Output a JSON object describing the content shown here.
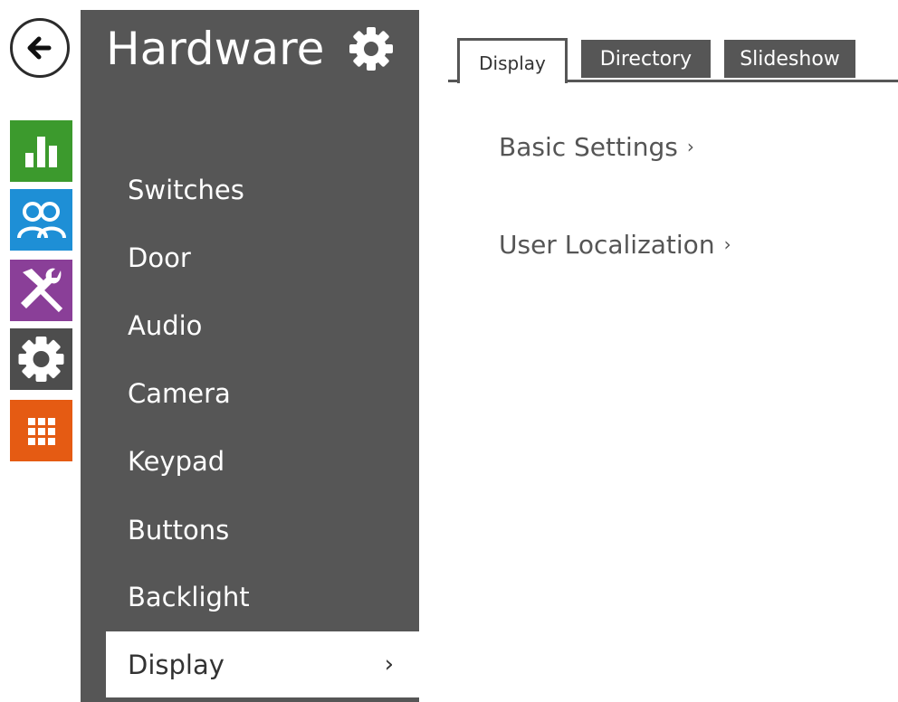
{
  "sidebar": {
    "title": "Hardware",
    "items": [
      {
        "label": "Switches"
      },
      {
        "label": "Door"
      },
      {
        "label": "Audio"
      },
      {
        "label": "Camera"
      },
      {
        "label": "Keypad"
      },
      {
        "label": "Buttons"
      },
      {
        "label": "Backlight"
      },
      {
        "label": "Display",
        "active": true
      }
    ],
    "active_chevron": "›"
  },
  "left_icons": [
    {
      "name": "status-chart-icon",
      "color": "#3c9a2d"
    },
    {
      "name": "users-icon",
      "color": "#1e8fd6"
    },
    {
      "name": "services-tools-icon",
      "color": "#8a3f98"
    },
    {
      "name": "hardware-gear-icon",
      "color": "#4d4d4d"
    },
    {
      "name": "system-grid-icon",
      "color": "#e55b13"
    }
  ],
  "tabs": [
    {
      "label": "Display",
      "active": true
    },
    {
      "label": "Directory"
    },
    {
      "label": "Slideshow"
    }
  ],
  "content": {
    "links": [
      {
        "label": "Basic Settings",
        "arrow": "›"
      },
      {
        "label": "User Localization",
        "arrow": "›"
      }
    ]
  }
}
